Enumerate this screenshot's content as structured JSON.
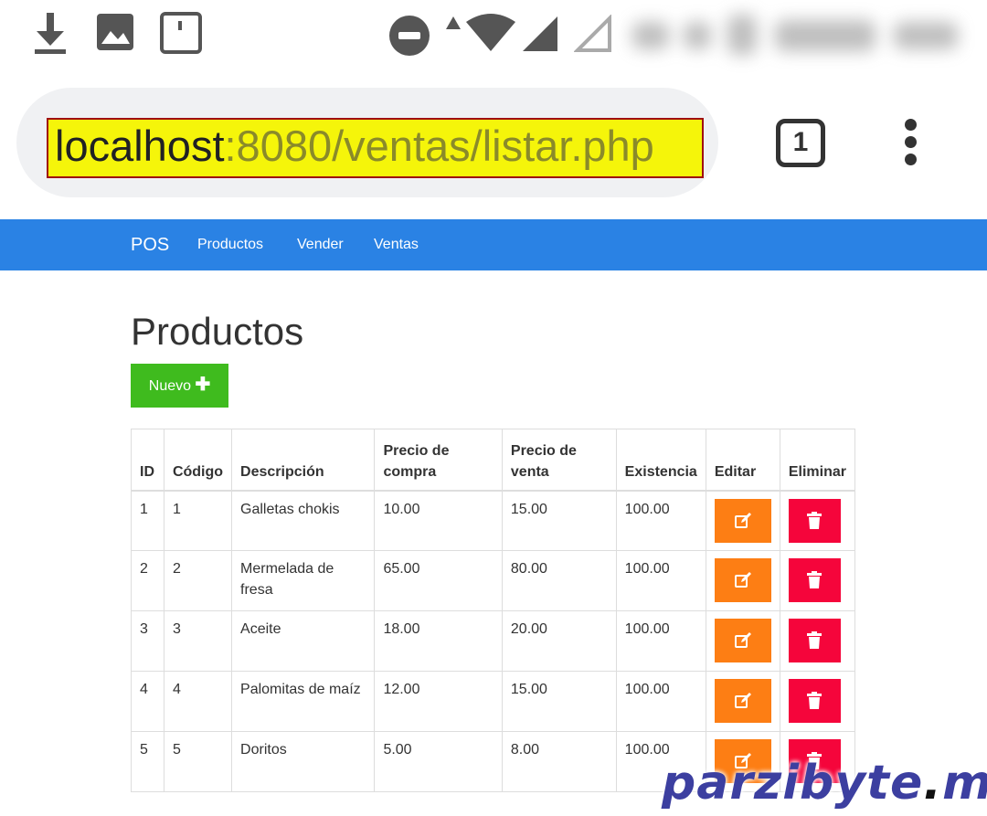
{
  "status_bar": {
    "icons": [
      "download-icon",
      "image-icon",
      "screenshot-frame-icon",
      "do-not-disturb-icon",
      "data-arrow-icon",
      "wifi-icon",
      "cell-signal-icon",
      "cell-signal-empty-icon"
    ]
  },
  "browser": {
    "url_host": "localhost",
    "url_path": ":8080/ventas/listar.php",
    "tab_count": "1",
    "highlight_color": "#f5f50a"
  },
  "navbar": {
    "brand": "POS",
    "links": [
      "Productos",
      "Vender",
      "Ventas"
    ],
    "color": "#2a82e4"
  },
  "main": {
    "title": "Productos",
    "new_button_label": "Nuevo",
    "new_button_icon": "plus-icon",
    "table": {
      "headers": [
        "ID",
        "Código",
        "Descripción",
        "Precio de compra",
        "Precio de venta",
        "Existencia",
        "Editar",
        "Eliminar"
      ],
      "rows": [
        [
          "1",
          "1",
          "Galletas chokis",
          "10.00",
          "15.00",
          "100.00"
        ],
        [
          "2",
          "2",
          "Mermelada de fresa",
          "65.00",
          "80.00",
          "100.00"
        ],
        [
          "3",
          "3",
          "Aceite",
          "18.00",
          "20.00",
          "100.00"
        ],
        [
          "4",
          "4",
          "Palomitas de maíz",
          "12.00",
          "15.00",
          "100.00"
        ],
        [
          "5",
          "5",
          "Doritos",
          "5.00",
          "8.00",
          "100.00"
        ]
      ],
      "edit_icon": "edit-icon",
      "delete_icon": "trash-icon",
      "edit_color": "#fd7e14",
      "delete_color": "#f5053b"
    }
  },
  "watermark": {
    "part1": "parzibyte",
    "dot": ".",
    "part2": "me"
  }
}
